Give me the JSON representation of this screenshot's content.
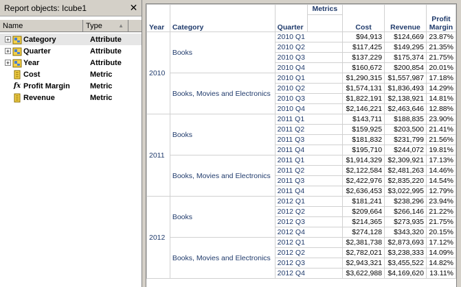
{
  "panel": {
    "title": "Report objects: Icube1",
    "columns": {
      "name": "Name",
      "type": "Type"
    },
    "objects": [
      {
        "name": "Category",
        "type": "Attribute",
        "kind": "attribute",
        "expandable": true
      },
      {
        "name": "Quarter",
        "type": "Attribute",
        "kind": "attribute",
        "expandable": true
      },
      {
        "name": "Year",
        "type": "Attribute",
        "kind": "attribute",
        "expandable": true
      },
      {
        "name": "Cost",
        "type": "Metric",
        "kind": "metric",
        "expandable": false
      },
      {
        "name": "Profit Margin",
        "type": "Metric",
        "kind": "derived",
        "expandable": false
      },
      {
        "name": "Revenue",
        "type": "Metric",
        "kind": "metric",
        "expandable": false
      }
    ]
  },
  "grid": {
    "headers": {
      "year": "Year",
      "category": "Category",
      "quarter": "Quarter",
      "metrics": "Metrics",
      "cost": "Cost",
      "revenue": "Revenue",
      "profit_margin_line1": "Profit",
      "profit_margin_line2": "Margin"
    },
    "years": [
      {
        "year": "2010",
        "groups": [
          {
            "category": "Books",
            "rows": [
              [
                "2010 Q1",
                "$94,913",
                "$124,669",
                "23.87%"
              ],
              [
                "2010 Q2",
                "$117,425",
                "$149,295",
                "21.35%"
              ],
              [
                "2010 Q3",
                "$137,229",
                "$175,374",
                "21.75%"
              ],
              [
                "2010 Q4",
                "$160,672",
                "$200,854",
                "20.01%"
              ]
            ]
          },
          {
            "category": "Books, Movies and Electronics",
            "rows": [
              [
                "2010 Q1",
                "$1,290,315",
                "$1,557,987",
                "17.18%"
              ],
              [
                "2010 Q2",
                "$1,574,131",
                "$1,836,493",
                "14.29%"
              ],
              [
                "2010 Q3",
                "$1,822,191",
                "$2,138,921",
                "14.81%"
              ],
              [
                "2010 Q4",
                "$2,146,221",
                "$2,463,646",
                "12.88%"
              ]
            ]
          }
        ]
      },
      {
        "year": "2011",
        "groups": [
          {
            "category": "Books",
            "rows": [
              [
                "2011 Q1",
                "$143,711",
                "$188,835",
                "23.90%"
              ],
              [
                "2011 Q2",
                "$159,925",
                "$203,500",
                "21.41%"
              ],
              [
                "2011 Q3",
                "$181,832",
                "$231,799",
                "21.56%"
              ],
              [
                "2011 Q4",
                "$195,710",
                "$244,072",
                "19.81%"
              ]
            ]
          },
          {
            "category": "Books, Movies and Electronics",
            "rows": [
              [
                "2011 Q1",
                "$1,914,329",
                "$2,309,921",
                "17.13%"
              ],
              [
                "2011 Q2",
                "$2,122,584",
                "$2,481,263",
                "14.46%"
              ],
              [
                "2011 Q3",
                "$2,422,976",
                "$2,835,220",
                "14.54%"
              ],
              [
                "2011 Q4",
                "$2,636,453",
                "$3,022,995",
                "12.79%"
              ]
            ]
          }
        ]
      },
      {
        "year": "2012",
        "groups": [
          {
            "category": "Books",
            "rows": [
              [
                "2012 Q1",
                "$181,241",
                "$238,296",
                "23.94%"
              ],
              [
                "2012 Q2",
                "$209,664",
                "$266,146",
                "21.22%"
              ],
              [
                "2012 Q3",
                "$214,365",
                "$273,935",
                "21.75%"
              ],
              [
                "2012 Q4",
                "$274,128",
                "$343,320",
                "20.15%"
              ]
            ]
          },
          {
            "category": "Books, Movies and Electronics",
            "rows": [
              [
                "2012 Q1",
                "$2,381,738",
                "$2,873,693",
                "17.12%"
              ],
              [
                "2012 Q2",
                "$2,782,021",
                "$3,238,333",
                "14.09%"
              ],
              [
                "2012 Q3",
                "$2,943,321",
                "$3,455,522",
                "14.82%"
              ],
              [
                "2012 Q4",
                "$3,622,988",
                "$4,169,620",
                "13.11%"
              ]
            ]
          }
        ]
      }
    ]
  }
}
